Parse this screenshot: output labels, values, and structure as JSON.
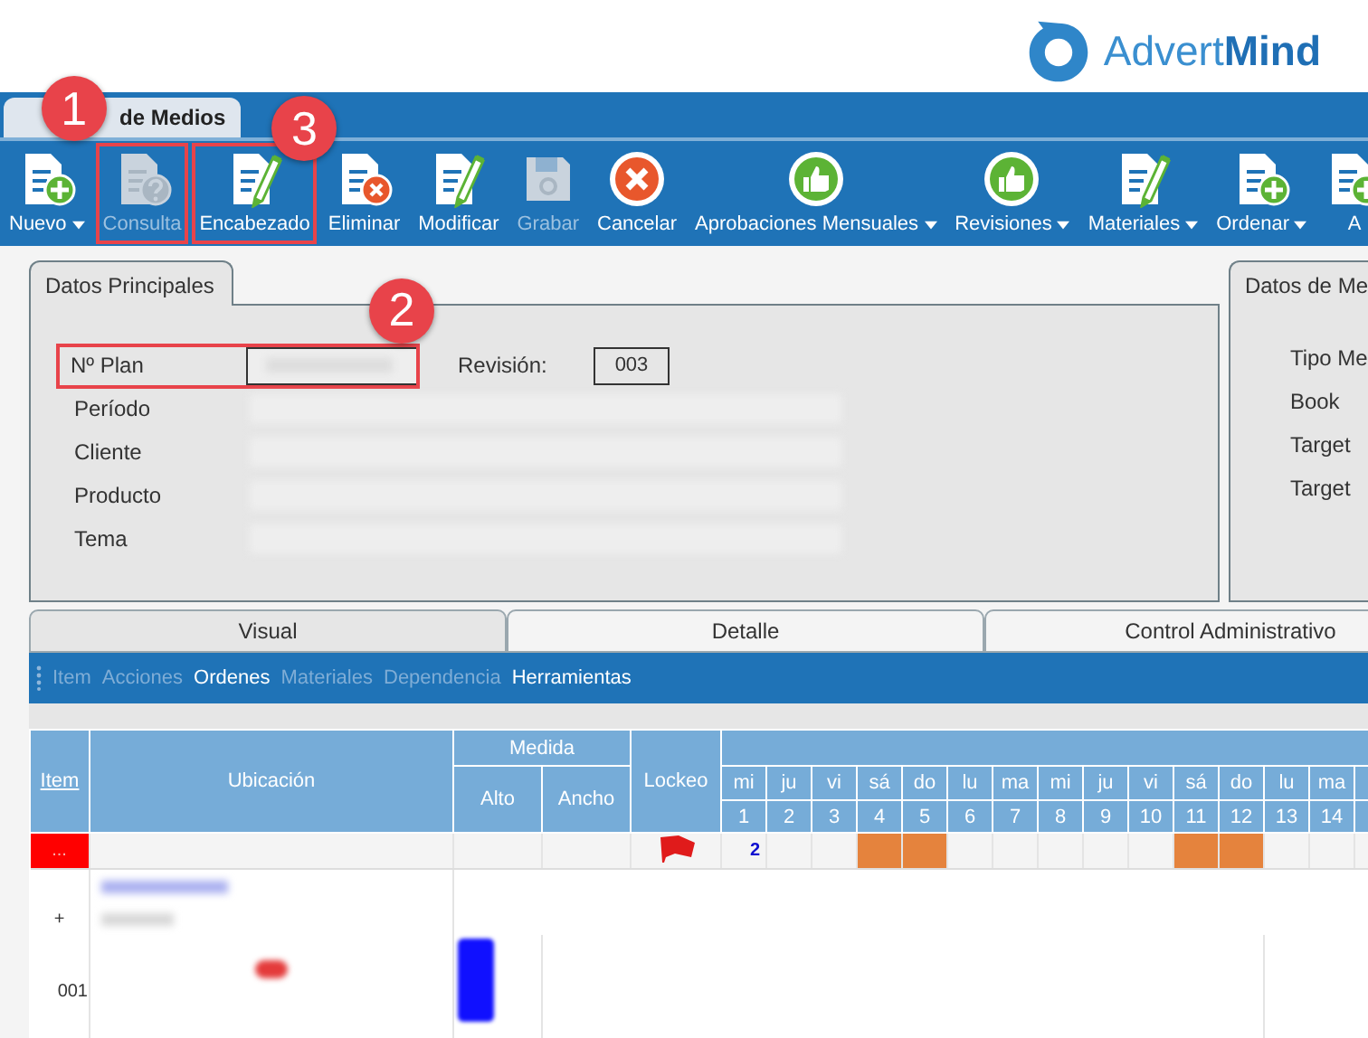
{
  "logo": {
    "name": [
      "Advert",
      "Mind"
    ]
  },
  "window_tab": {
    "title": "de Medios"
  },
  "toolbar": [
    {
      "label": "Nuevo",
      "kind": "doc-plus",
      "dropdown": true,
      "disabled": false
    },
    {
      "label": "Consulta",
      "kind": "doc-question",
      "dropdown": false,
      "disabled": true
    },
    {
      "label": "Encabezado",
      "kind": "doc-pencil",
      "dropdown": false,
      "disabled": false
    },
    {
      "label": "Eliminar",
      "kind": "doc-x",
      "dropdown": false,
      "disabled": false
    },
    {
      "label": "Modificar",
      "kind": "doc-pencil",
      "dropdown": false,
      "disabled": false
    },
    {
      "label": "Grabar",
      "kind": "floppy",
      "dropdown": false,
      "disabled": true
    },
    {
      "label": "Cancelar",
      "kind": "cancel",
      "dropdown": false,
      "disabled": false
    },
    {
      "label": "Aprobaciones Mensuales",
      "kind": "thumb",
      "dropdown": true,
      "disabled": false
    },
    {
      "label": "Revisiones",
      "kind": "thumb",
      "dropdown": true,
      "disabled": false
    },
    {
      "label": "Materiales",
      "kind": "doc-pencil",
      "dropdown": true,
      "disabled": false
    },
    {
      "label": "Ordenar",
      "kind": "doc-plus",
      "dropdown": true,
      "disabled": false
    },
    {
      "label": "A",
      "kind": "doc-plus",
      "dropdown": false,
      "disabled": false
    }
  ],
  "main_panel": {
    "title": "Datos Principales",
    "fields": [
      {
        "label": "Nº Plan",
        "kind": "boxed"
      },
      {
        "label": "Período",
        "kind": "wide"
      },
      {
        "label": "Cliente",
        "kind": "wide"
      },
      {
        "label": "Producto",
        "kind": "wide"
      },
      {
        "label": "Tema",
        "kind": "wide"
      }
    ],
    "revision": {
      "label": "Revisión:",
      "value": "003"
    }
  },
  "side_panel": {
    "title": "Datos de Me",
    "labels": [
      "Tipo Me",
      "Book",
      "Target",
      "Target"
    ]
  },
  "detail_tabs": [
    {
      "label": "Visual",
      "selected": true
    },
    {
      "label": "Detalle",
      "selected": false
    },
    {
      "label": "Control Administrativo",
      "selected": false
    }
  ],
  "menu": [
    {
      "label": "Item",
      "disabled": true
    },
    {
      "label": "Acciones",
      "disabled": true
    },
    {
      "label": "Ordenes",
      "disabled": false
    },
    {
      "label": "Materiales",
      "disabled": true
    },
    {
      "label": "Dependencia",
      "disabled": true
    },
    {
      "label": "Herramientas",
      "disabled": false
    }
  ],
  "grid": {
    "columns": {
      "item": "Item",
      "location": "Ubicación",
      "size": "Medida",
      "height": "Alto",
      "width": "Ancho",
      "lock": "Lockeo"
    },
    "days": [
      {
        "weekday": "mi",
        "date": "1",
        "weekend": false,
        "value": "2"
      },
      {
        "weekday": "ju",
        "date": "2",
        "weekend": false
      },
      {
        "weekday": "vi",
        "date": "3",
        "weekend": false
      },
      {
        "weekday": "sá",
        "date": "4",
        "weekend": true
      },
      {
        "weekday": "do",
        "date": "5",
        "weekend": true
      },
      {
        "weekday": "lu",
        "date": "6",
        "weekend": false
      },
      {
        "weekday": "ma",
        "date": "7",
        "weekend": false
      },
      {
        "weekday": "mi",
        "date": "8",
        "weekend": false
      },
      {
        "weekday": "ju",
        "date": "9",
        "weekend": false
      },
      {
        "weekday": "vi",
        "date": "10",
        "weekend": false
      },
      {
        "weekday": "sá",
        "date": "11",
        "weekend": true
      },
      {
        "weekday": "do",
        "date": "12",
        "weekend": true
      },
      {
        "weekday": "lu",
        "date": "13",
        "weekend": false
      },
      {
        "weekday": "ma",
        "date": "14",
        "weekend": false
      }
    ],
    "rows": [
      {
        "kind": "filter",
        "item": "..."
      },
      {
        "kind": "group"
      },
      {
        "kind": "add",
        "item": "+"
      },
      {
        "kind": "entry",
        "item": "001"
      }
    ]
  },
  "annotations": [
    {
      "number": "1"
    },
    {
      "number": "2"
    },
    {
      "number": "3"
    }
  ]
}
